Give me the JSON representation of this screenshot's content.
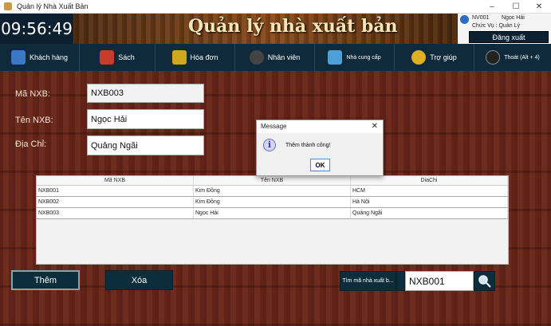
{
  "window": {
    "title": "Quản lý Nhà Xuất Bản",
    "min": "–",
    "max": "☐",
    "close": "✕"
  },
  "header": {
    "clock": "09:56:49",
    "title": "Quản lý nhà xuất bản",
    "user_id": "NV001",
    "user_name": "Ngọc Hải",
    "role": "Chức Vụ : Quản Lý",
    "logout": "Đăng xuất"
  },
  "nav": {
    "items": [
      {
        "label": "Khách hàng",
        "icon": "customer-icon",
        "color": "#3a78c6"
      },
      {
        "label": "Sách",
        "icon": "book-icon",
        "color": "#c93a2b"
      },
      {
        "label": "Hóa đơn",
        "icon": "invoice-icon",
        "color": "#d0a820"
      },
      {
        "label": "Nhân viên",
        "icon": "employee-icon",
        "color": "#444444"
      },
      {
        "label": "Nhà cung cấp",
        "icon": "supplier-icon",
        "color": "#4ea0d8"
      },
      {
        "label": "Trợ giúp",
        "icon": "help-icon",
        "color": "#e0b020"
      },
      {
        "label": "Thoát (Alt + 4)",
        "icon": "exit-icon",
        "color": "#222222"
      }
    ]
  },
  "form": {
    "ma_label": "Mã NXB:",
    "ma_value": "NXB003",
    "ten_label": "Tên NXB:",
    "ten_value": "Ngọc Hải",
    "diachi_label": "Địa Chỉ:",
    "diachi_value": "Quảng Ngãi"
  },
  "table": {
    "headers": [
      "Mã NXB",
      "Tên NXB",
      "DiaChi"
    ],
    "rows": [
      [
        "NXB001",
        "Kim Đồng",
        "HCM"
      ],
      [
        "NXB002",
        "Kim Đồng",
        "Hà Nội"
      ],
      [
        "NXB003",
        "Ngọc Hải",
        "Quảng Ngãi"
      ]
    ]
  },
  "buttons": {
    "add": "Thêm",
    "delete": "Xóa",
    "search_by": "Tìm mã nhà xuất b..."
  },
  "search": {
    "value": "NXB001"
  },
  "dialog": {
    "title": "Message",
    "close": "✕",
    "message": "Thêm thành công!",
    "ok": "OK"
  }
}
